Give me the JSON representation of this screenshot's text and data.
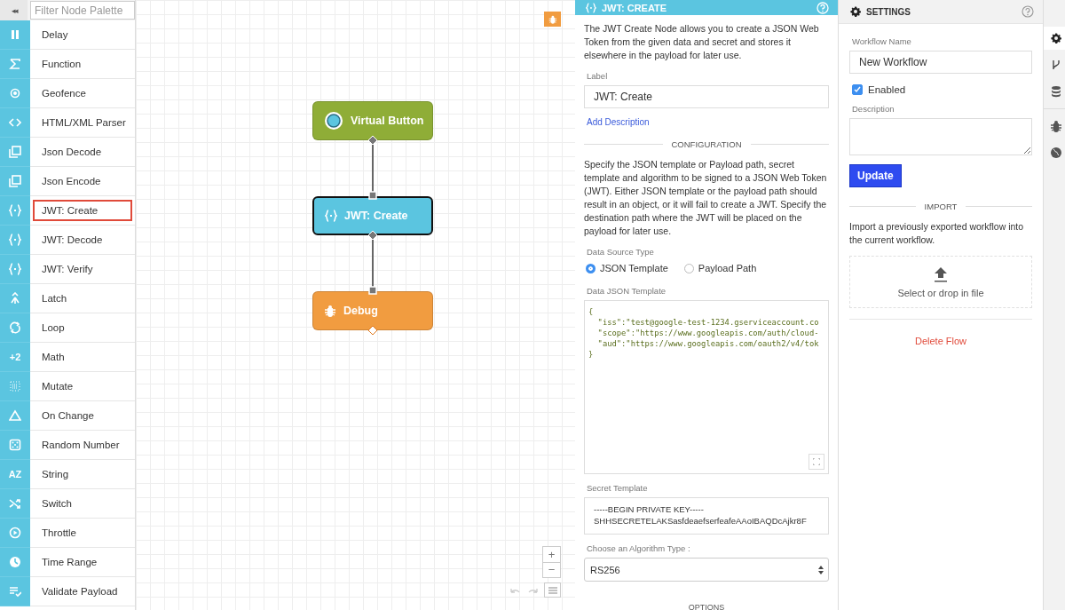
{
  "palette": {
    "collapse_glyph": "◂◂",
    "filter_placeholder": "Filter Node Palette",
    "items": [
      {
        "label": "Delay",
        "selected": false
      },
      {
        "label": "Function",
        "selected": false
      },
      {
        "label": "Geofence",
        "selected": false
      },
      {
        "label": "HTML/XML Parser",
        "selected": false
      },
      {
        "label": "Json Decode",
        "selected": false
      },
      {
        "label": "Json Encode",
        "selected": false
      },
      {
        "label": "JWT: Create",
        "selected": true
      },
      {
        "label": "JWT: Decode",
        "selected": false
      },
      {
        "label": "JWT: Verify",
        "selected": false
      },
      {
        "label": "Latch",
        "selected": false
      },
      {
        "label": "Loop",
        "selected": false
      },
      {
        "label": "Math",
        "selected": false,
        "icon_text": "+2"
      },
      {
        "label": "Mutate",
        "selected": false
      },
      {
        "label": "On Change",
        "selected": false
      },
      {
        "label": "Random Number",
        "selected": false
      },
      {
        "label": "String",
        "selected": false,
        "icon_text": "AZ"
      },
      {
        "label": "Switch",
        "selected": false
      },
      {
        "label": "Throttle",
        "selected": false
      },
      {
        "label": "Time Range",
        "selected": false
      },
      {
        "label": "Validate Payload",
        "selected": false
      }
    ]
  },
  "canvas": {
    "nodes": [
      {
        "kind": "trigger",
        "label": "Virtual Button",
        "color": "#8fad37",
        "selected": false
      },
      {
        "kind": "logic",
        "label": "JWT: Create",
        "color": "#5bc5e0",
        "selected": true
      },
      {
        "kind": "output",
        "label": "Debug",
        "color": "#f19c40",
        "selected": false
      }
    ],
    "zoom_in": "+",
    "zoom_out": "−"
  },
  "node_panel": {
    "title": "JWT: CREATE",
    "intro": "The JWT Create Node allows you to create a JSON Web Token from the given data and secret and stores it elsewhere in the payload for later use.",
    "label_caption": "Label",
    "label_value": "JWT: Create",
    "add_description": "Add Description",
    "config_heading": "CONFIGURATION",
    "config_text": "Specify the JSON template or Payload path, secret template and algorithm to be signed to a JSON Web Token (JWT). Either JSON template or the payload path should result in an object, or it will fail to create a JWT. Specify the destination path where the JWT will be placed on the payload for later use.",
    "source_caption": "Data Source Type",
    "source_options": [
      {
        "label": "JSON Template",
        "selected": true
      },
      {
        "label": "Payload Path",
        "selected": false
      }
    ],
    "template_caption": "Data JSON Template",
    "template_lines": [
      "{",
      "  \"iss\":\"test@google-test-1234.gserviceaccount.co",
      "  \"scope\":\"https://www.googleapis.com/auth/cloud-",
      "  \"aud\":\"https://www.googleapis.com/oauth2/v4/tok",
      "}"
    ],
    "secret_caption": "Secret Template",
    "secret_lines": [
      "-----BEGIN PRIVATE KEY-----",
      "SHHSECRETELAKSasfdeaefserfeafeAAoIBAQDcAjkr8F"
    ],
    "algorithm_caption": "Choose an Algorithm Type :",
    "algorithm_value": "RS256",
    "options_heading": "OPTIONS"
  },
  "settings": {
    "title": "SETTINGS",
    "name_caption": "Workflow Name",
    "name_value": "New Workflow",
    "enabled_label": "Enabled",
    "enabled": true,
    "description_caption": "Description",
    "update_button": "Update",
    "import_heading": "IMPORT",
    "import_text": "Import a previously exported workflow into the current workflow.",
    "drop_text": "Select or drop in file",
    "delete_link": "Delete Flow"
  },
  "rail": [
    {
      "selected": true
    },
    {
      "selected": false
    },
    {
      "selected": false
    },
    {
      "selected": false
    },
    {
      "selected": false
    }
  ]
}
